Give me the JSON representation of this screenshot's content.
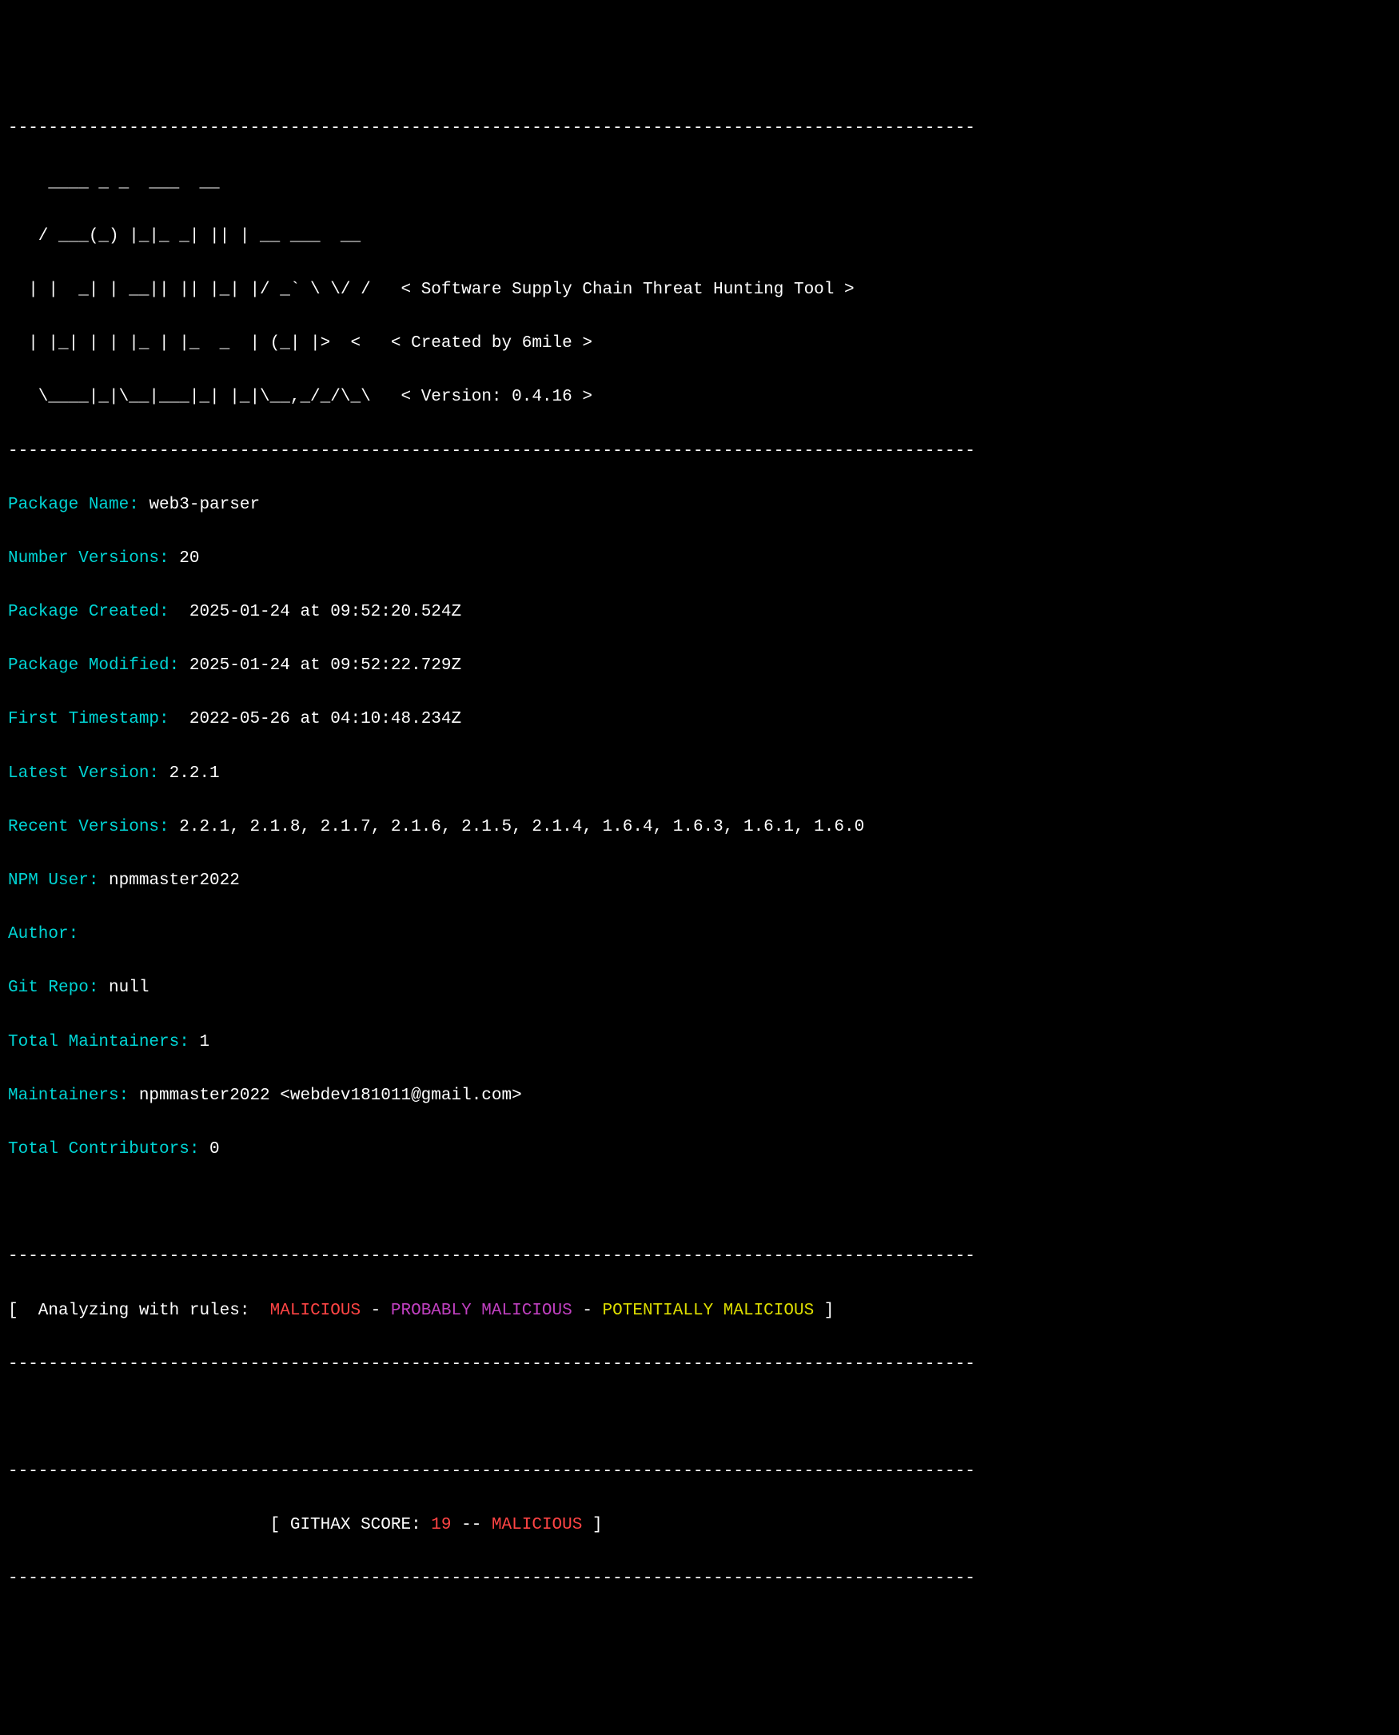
{
  "divider": "------------------------------------------------------------------------------------------------",
  "ascii": {
    "l1": "    ____ _ _  ___  __     ",
    "l2": "   / ___(_) |_|_ _| || | __ ___  __",
    "l3": "  | |  _| | __|| || |_| |/ _` \\ \\/ /",
    "l4": "  | |_| | | |_ | |_  _  | (_| |>  <",
    "l5": "   \\____|_|\\__|___|_| |_|\\__,_/_/\\_\\"
  },
  "tagline1": "< Software Supply Chain Threat Hunting Tool >",
  "tagline2": "< Created by 6mile >",
  "tagline3": "< Version: 0.4.16 >",
  "fields": {
    "packageName": {
      "label": "Package Name: ",
      "value": "web3-parser"
    },
    "numberVersions": {
      "label": "Number Versions: ",
      "value": "20"
    },
    "packageCreated": {
      "label": "Package Created:  ",
      "value": "2025-01-24 at 09:52:20.524Z"
    },
    "packageModified": {
      "label": "Package Modified: ",
      "value": "2025-01-24 at 09:52:22.729Z"
    },
    "firstTimestamp": {
      "label": "First Timestamp:  ",
      "value": "2022-05-26 at 04:10:48.234Z"
    },
    "latestVersion": {
      "label": "Latest Version: ",
      "value": "2.2.1"
    },
    "recentVersions": {
      "label": "Recent Versions: ",
      "value": "2.2.1, 2.1.8, 2.1.7, 2.1.6, 2.1.5, 2.1.4, 1.6.4, 1.6.3, 1.6.1, 1.6.0"
    },
    "npmUser": {
      "label": "NPM User: ",
      "value": "npmmaster2022"
    },
    "author": {
      "label": "Author:",
      "value": ""
    },
    "gitRepo": {
      "label": "Git Repo: ",
      "value": "null"
    },
    "totalMaintainers": {
      "label": "Total Maintainers: ",
      "value": "1"
    },
    "maintainers": {
      "label": "Maintainers: ",
      "value": "npmmaster2022 <webdev181011@gmail.com>"
    },
    "totalContributors": {
      "label": "Total Contributors: ",
      "value": "0"
    }
  },
  "analyzing": {
    "prefix": "[  Analyzing with rules:  ",
    "rule1": "MALICIOUS",
    "sep": " - ",
    "rule2": "PROBABLY MALICIOUS",
    "rule3": "POTENTIALLY MALICIOUS",
    "suffix": " ]"
  },
  "score": {
    "prefix": "                          [ GITHAX SCORE: ",
    "value": "19",
    "sep": " -- ",
    "verdict": "MALICIOUS",
    "suffix": " ]"
  }
}
